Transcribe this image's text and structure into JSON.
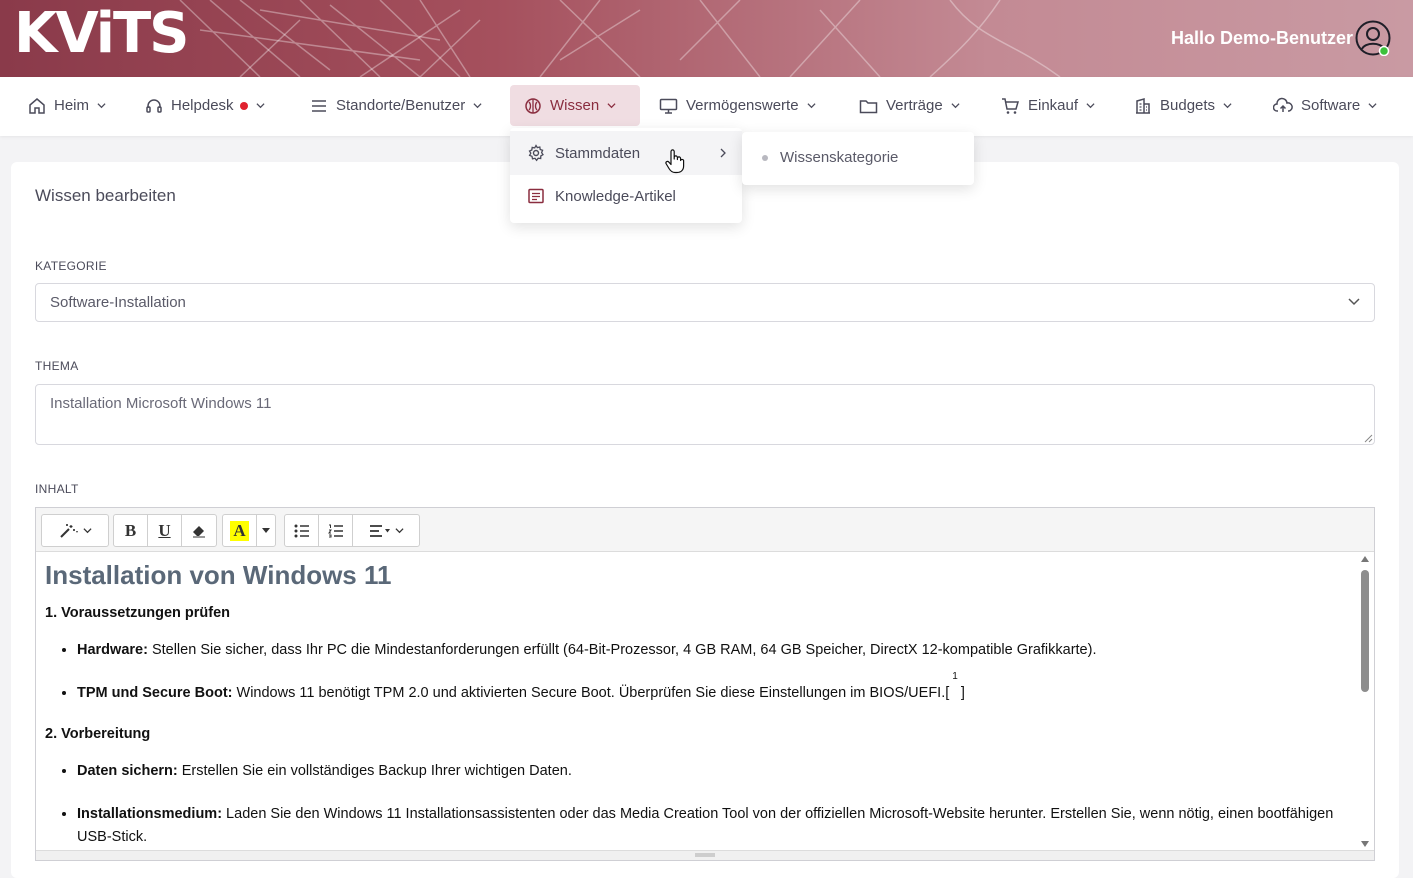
{
  "header": {
    "logo": "KViTS",
    "greeting": "Hallo Demo-Benutzer",
    "status_color": "#3cc13b"
  },
  "nav": [
    {
      "label": "Heim",
      "icon": "home-icon"
    },
    {
      "label": "Helpdesk",
      "icon": "headset-icon",
      "badge": true
    },
    {
      "label": "Standorte/Benutzer",
      "icon": "menu-lines-icon"
    },
    {
      "label": "Wissen",
      "icon": "brain-icon",
      "active": true
    },
    {
      "label": "Vermögenswerte",
      "icon": "monitor-icon"
    },
    {
      "label": "Verträge",
      "icon": "folder-icon"
    },
    {
      "label": "Einkauf",
      "icon": "cart-icon"
    },
    {
      "label": "Budgets",
      "icon": "building-icon"
    },
    {
      "label": "Software",
      "icon": "cloud-upload-icon"
    }
  ],
  "dropdown": {
    "items": [
      {
        "label": "Stammdaten",
        "icon": "gear-icon"
      },
      {
        "label": "Knowledge-Artikel",
        "icon": "article-icon"
      }
    ],
    "submenu": {
      "label": "Wissenskategorie"
    }
  },
  "form": {
    "title": "Wissen bearbeiten",
    "kategorie_label": "KATEGORIE",
    "kategorie_value": "Software-Installation",
    "thema_label": "THEMA",
    "thema_value": "Installation Microsoft Windows 11",
    "inhalt_label": "INHALT"
  },
  "editor": {
    "heading": "Installation von Windows 11",
    "section1": "1. Voraussetzungen prüfen",
    "s1_items": [
      {
        "bold": "Hardware:",
        "text": " Stellen Sie sicher, dass Ihr PC die Mindestanforderungen erfüllt (64-Bit-Prozessor, 4 GB RAM, 64 GB Speicher, DirectX 12-kompatible Grafikkarte)."
      },
      {
        "bold": "TPM und Secure Boot:",
        "text": " Windows 11 benötigt TPM 2.0 und aktivierten Secure Boot. Überprüfen Sie diese Einstellungen im BIOS/UEFI.[",
        "ref": "1",
        "tail": "]"
      }
    ],
    "section2": "2. Vorbereitung",
    "s2_items": [
      {
        "bold": "Daten sichern:",
        "text": " Erstellen Sie ein vollständiges Backup Ihrer wichtigen Daten."
      },
      {
        "bold": "Installationsmedium:",
        "text": " Laden Sie den Windows 11 Installationsassistenten oder das Media Creation Tool von der offiziellen Microsoft-Website herunter. Erstellen Sie, wenn nötig, einen bootfähigen USB-Stick."
      }
    ],
    "toolbar": {
      "bold": "B",
      "underline": "U",
      "color": "A"
    }
  }
}
